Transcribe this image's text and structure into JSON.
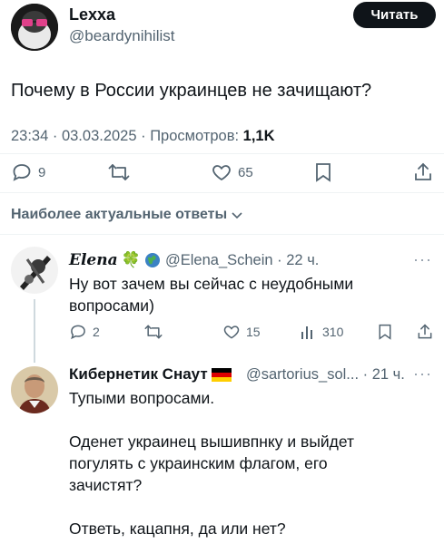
{
  "main_tweet": {
    "author_name": "Lexxa",
    "author_handle": "@beardynihilist",
    "follow_label": "Читать",
    "text": "Почему в России украинцев не зачищают?",
    "timestamp": "23:34 · 03.03.2025 · Просмотров: ",
    "views": "1,1K",
    "actions": {
      "replies": "9",
      "likes": "65"
    }
  },
  "section_label": "Наиболее актуальные ответы",
  "replies": [
    {
      "author_name": "Elena",
      "emoji": "🍀",
      "author_handle": "@Elena_Schein",
      "time": "· 22 ч.",
      "text_lines": [
        "Ну вот зачем вы сейчас с неудобными",
        "вопросами)"
      ],
      "actions": {
        "replies": "2",
        "likes": "15",
        "views": "310"
      },
      "more": "···"
    },
    {
      "author_name": "Кибернетик Снаут",
      "author_handle": "@sartorius_sol...",
      "time": "· 21 ч.",
      "text_paragraphs": [
        "Тупыми вопросами.",
        "Оденет украинец вышивпнку и выйдет погулять  с украинским флагом, его зачистят?",
        "Ответь, кацапня, да или нет?"
      ],
      "more": "···"
    }
  ],
  "colors": {
    "text": "#0f1419",
    "muted": "#536471",
    "divider": "#eff3f4",
    "button_bg": "#0f1419"
  }
}
